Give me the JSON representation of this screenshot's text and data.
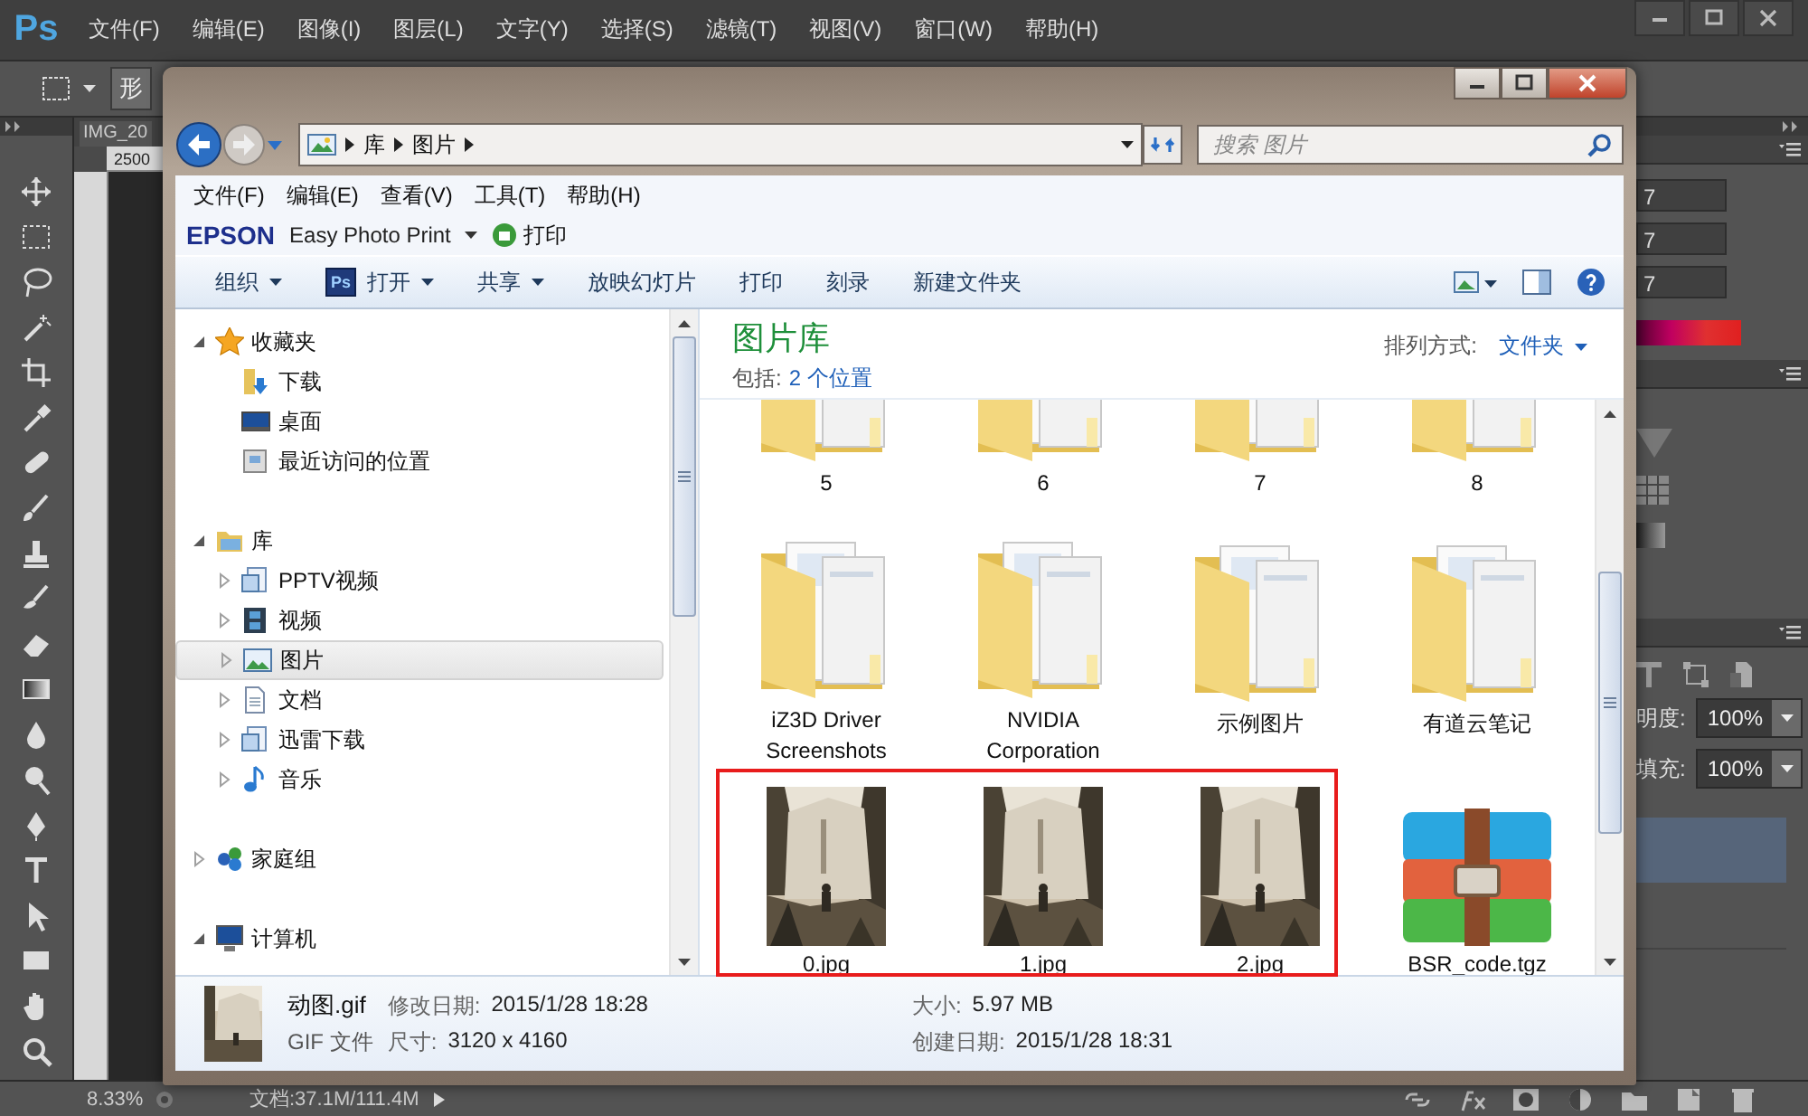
{
  "photoshop": {
    "logo": "Ps",
    "menu": [
      "文件(F)",
      "编辑(E)",
      "图像(I)",
      "图层(L)",
      "文字(Y)",
      "选择(S)",
      "滤镜(T)",
      "视图(V)",
      "窗口(W)",
      "帮助(H)"
    ],
    "options_bar": {
      "button": "形"
    },
    "document": {
      "tab": "IMG_20",
      "ruler": "2500"
    },
    "right_panel": {
      "fields": [
        "7",
        "7",
        "7"
      ],
      "opacity": {
        "label": "明度:",
        "value": "100%"
      },
      "fill": {
        "label": "填充:",
        "value": "100%"
      }
    },
    "status_bar": {
      "zoom": "8.33%",
      "doc_info": "文档:37.1M/111.4M"
    }
  },
  "explorer": {
    "address": {
      "breadcrumb": [
        "库",
        "图片"
      ]
    },
    "search": {
      "placeholder": "搜索 图片"
    },
    "menu": [
      "文件(F)",
      "编辑(E)",
      "查看(V)",
      "工具(T)",
      "帮助(H)"
    ],
    "epson_bar": {
      "brand": "EPSON",
      "app": "Easy Photo Print",
      "print": "打印"
    },
    "toolbar": [
      {
        "label": "组织",
        "kind": "plain",
        "dropdown": true
      },
      {
        "label": "打开",
        "kind": "app",
        "icon_text": "Ps",
        "dropdown": true
      },
      {
        "label": "共享",
        "kind": "plain",
        "dropdown": true
      },
      {
        "label": "放映幻灯片",
        "kind": "plain",
        "dropdown": false
      },
      {
        "label": "打印",
        "kind": "plain",
        "dropdown": false
      },
      {
        "label": "刻录",
        "kind": "plain",
        "dropdown": false
      },
      {
        "label": "新建文件夹",
        "kind": "plain",
        "dropdown": false
      }
    ],
    "nav": [
      {
        "label": "收藏夹",
        "expanded": true,
        "selected": false,
        "children": [
          {
            "label": "下载",
            "selected": false
          },
          {
            "label": "桌面",
            "selected": false
          },
          {
            "label": "最近访问的位置",
            "selected": false
          }
        ]
      },
      {
        "label": "库",
        "expanded": true,
        "selected": false,
        "children": [
          {
            "label": "PPTV视频",
            "expanded": false,
            "selected": false
          },
          {
            "label": "视频",
            "expanded": false,
            "selected": false
          },
          {
            "label": "图片",
            "expanded": false,
            "selected": true
          },
          {
            "label": "文档",
            "expanded": false,
            "selected": false
          },
          {
            "label": "迅雷下载",
            "expanded": false,
            "selected": false
          },
          {
            "label": "音乐",
            "expanded": false,
            "selected": false
          }
        ]
      },
      {
        "label": "家庭组",
        "expanded": false,
        "selected": false
      },
      {
        "label": "计算机",
        "expanded": true,
        "selected": false
      }
    ],
    "library": {
      "title": "图片库",
      "includes_label": "包括:",
      "includes_link": "2 个位置",
      "arrange_label": "排列方式:",
      "arrange_value": "文件夹"
    },
    "items": [
      {
        "name": "5",
        "kind": "folder"
      },
      {
        "name": "6",
        "kind": "folder"
      },
      {
        "name": "7",
        "kind": "folder"
      },
      {
        "name": "8",
        "kind": "folder"
      },
      {
        "name": "iZ3D Driver Screenshots",
        "kind": "folder"
      },
      {
        "name": "NVIDIA Corporation",
        "kind": "folder"
      },
      {
        "name": "示例图片",
        "kind": "folder"
      },
      {
        "name": "有道云笔记",
        "kind": "folder"
      },
      {
        "name": "0.jpg"
      },
      {
        "name": "1.jpg"
      },
      {
        "name": "2.jpg"
      },
      {
        "name": "BSR_code.tgz",
        "kind": "archive"
      }
    ],
    "annotation": {
      "kind": "rectangle"
    },
    "details": {
      "name": "动图.gif",
      "type": "GIF 文件",
      "fields": [
        {
          "label": "修改日期:",
          "value": "2015/1/28 18:28"
        },
        {
          "label": "尺寸:",
          "value": "3120 x 4160"
        },
        {
          "label": "大小:",
          "value": "5.97 MB"
        },
        {
          "label": "创建日期:",
          "value": "2015/1/28 18:31"
        }
      ]
    }
  }
}
